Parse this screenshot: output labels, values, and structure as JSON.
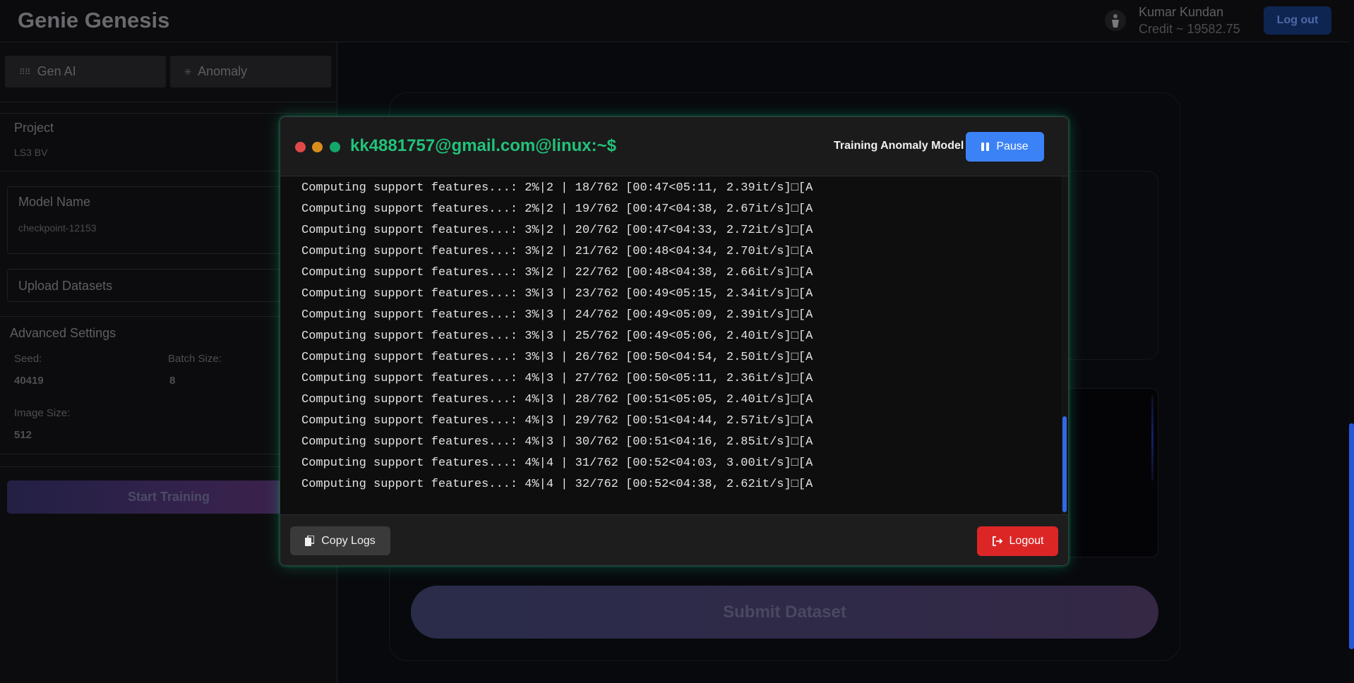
{
  "header": {
    "brand": "Genie Genesis",
    "user_name": "Kumar Kundan",
    "credit": "Credit ~ 19582.75",
    "logout_label": "Log out"
  },
  "sidebar": {
    "tabs": [
      {
        "label": "Gen AI",
        "icon": "grid-dots-icon"
      },
      {
        "label": "Anomaly",
        "icon": "sparkle-dots-icon"
      }
    ],
    "project_label": "Project",
    "project_value": "LS3 BV",
    "model_name_label": "Model Name",
    "model_name_value": "checkpoint-12153",
    "upload_label": "Upload Datasets",
    "advanced_title": "Advanced Settings",
    "seed_label": "Seed:",
    "seed_value": "40419",
    "batch_label": "Batch Size:",
    "batch_value": "8",
    "image_size_label": "Image Size:",
    "image_size_value": "512",
    "start_training_label": "Start Training"
  },
  "main": {
    "submit_label": "Submit Dataset"
  },
  "terminal": {
    "prompt": "kk4881757@gmail.com@linux:~$",
    "status": "Training Anomaly Model",
    "pause_label": "Pause",
    "copy_label": "Copy Logs",
    "logout_label": "Logout",
    "accent_color": "#10b981",
    "logs": [
      "Computing support features...: 2%|2 | 18/762 [00:47<05:11, 2.39it/s]□[A",
      "Computing support features...: 2%|2 | 19/762 [00:47<04:38, 2.67it/s]□[A",
      "Computing support features...: 3%|2 | 20/762 [00:47<04:33, 2.72it/s]□[A",
      "Computing support features...: 3%|2 | 21/762 [00:48<04:34, 2.70it/s]□[A",
      "Computing support features...: 3%|2 | 22/762 [00:48<04:38, 2.66it/s]□[A",
      "Computing support features...: 3%|3 | 23/762 [00:49<05:15, 2.34it/s]□[A",
      "Computing support features...: 3%|3 | 24/762 [00:49<05:09, 2.39it/s]□[A",
      "Computing support features...: 3%|3 | 25/762 [00:49<05:06, 2.40it/s]□[A",
      "Computing support features...: 3%|3 | 26/762 [00:50<04:54, 2.50it/s]□[A",
      "Computing support features...: 4%|3 | 27/762 [00:50<05:11, 2.36it/s]□[A",
      "Computing support features...: 4%|3 | 28/762 [00:51<05:05, 2.40it/s]□[A",
      "Computing support features...: 4%|3 | 29/762 [00:51<04:44, 2.57it/s]□[A",
      "Computing support features...: 4%|3 | 30/762 [00:51<04:16, 2.85it/s]□[A",
      "Computing support features...: 4%|4 | 31/762 [00:52<04:03, 3.00it/s]□[A",
      "Computing support features...: 4%|4 | 32/762 [00:52<04:38, 2.62it/s]□[A"
    ]
  }
}
